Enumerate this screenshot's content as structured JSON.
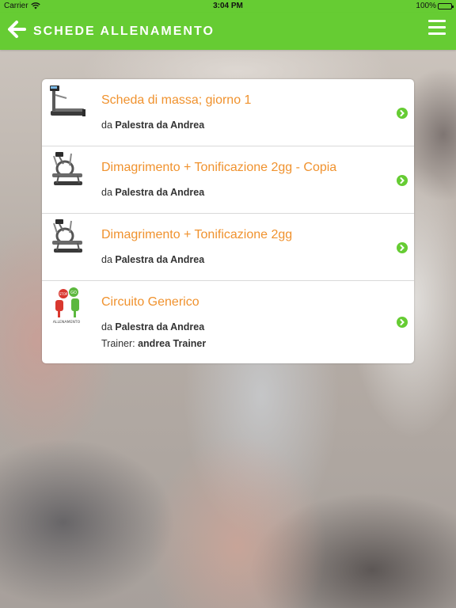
{
  "status_bar": {
    "carrier": "Carrier",
    "time": "3:04 PM",
    "battery": "100%"
  },
  "header": {
    "title": "SCHEDE ALLENAMENTO",
    "back_icon": "back-arrow-icon",
    "menu_icon": "hamburger-menu-icon"
  },
  "colors": {
    "accent": "#66cc33",
    "title_orange": "#f0922e"
  },
  "workouts": [
    {
      "title": "Scheda di massa; giorno 1",
      "by_prefix": "da",
      "gym": "Palestra da Andrea",
      "thumbnail": "treadmill-icon"
    },
    {
      "title": "Dimagrimento + Tonificazione 2gg - Copia",
      "by_prefix": "da",
      "gym": "Palestra da Andrea",
      "thumbnail": "elliptical-trainer-icon"
    },
    {
      "title": "Dimagrimento + Tonificazione 2gg",
      "by_prefix": "da",
      "gym": "Palestra da Andrea",
      "thumbnail": "elliptical-trainer-icon"
    },
    {
      "title": "Circuito Generico",
      "by_prefix": "da",
      "gym": "Palestra da Andrea",
      "trainer_prefix": "Trainer:",
      "trainer": "andrea Trainer",
      "thumbnail": "stop-go-allenamento-icon",
      "thumbnail_caption": "ALLENAMENTO",
      "thumbnail_badges": [
        "STOP",
        "GO"
      ]
    }
  ]
}
